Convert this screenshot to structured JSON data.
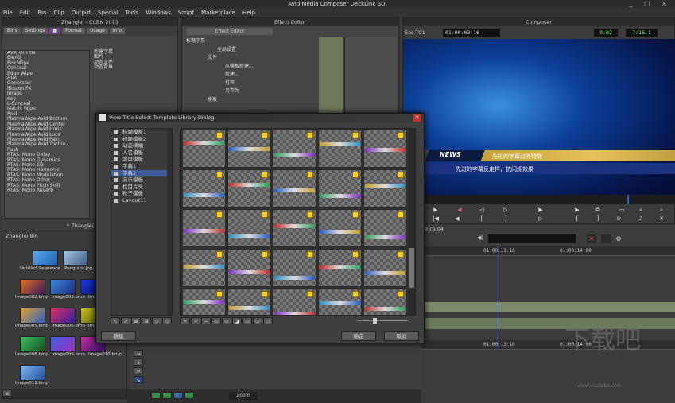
{
  "window": {
    "title": "Avid Media Composer DeckLink SDI",
    "controls": "_ □ ×"
  },
  "menu": [
    "File",
    "Edit",
    "Bin",
    "Clip",
    "Output",
    "Special",
    "Tools",
    "Windows",
    "Script",
    "Marketplace",
    "Help"
  ],
  "project": {
    "title": "Zhanglei - CCBN 2013",
    "tabs": [
      "Bins",
      "Settings",
      "Format",
      "Usage",
      "Info"
    ],
    "effects": [
      "AVX_UI Title",
      "Blend",
      "Box Wipe",
      "Conceal",
      "Edge Wipe",
      "Film",
      "Generator",
      "Illusion FX",
      "Image",
      "Key",
      "L-Conceal",
      "Matrix Wipe",
      "Peel",
      "PlasmaWipe Avid Bottom",
      "PlasmaWipe Avid Center",
      "PlasmaWipe Avid Horiz",
      "PlasmaWipe Avid Luca",
      "PlasmaWipe Avid Paint",
      "PlasmaWipe Avid Trichro",
      "Push",
      "RTAS: Mono Delay",
      "RTAS: Mono Dynamics",
      "RTAS: Mono EQ",
      "RTAS: Mono Harmonic",
      "RTAS: Mono Modulation",
      "RTAS: Mono Other",
      "RTAS: Mono Pitch Shift",
      "RTAS: Mono Reverb"
    ],
    "effect_types": [
      "新建字幕",
      "图片",
      "动态文件",
      "动态背景"
    ]
  },
  "effect_editor": {
    "title": "Effect Editor",
    "tab": "Effect Editor",
    "rows": [
      "标题字幕",
      "全局设置",
      "文件",
      "从模板新建...",
      "新建...",
      "打开",
      "另存为",
      "模板"
    ]
  },
  "composer": {
    "title": "Composer",
    "timecode_label": "Eas TC1",
    "timecode": "01:00:03:16",
    "right_tc_1": "9:02",
    "right_tc_2": "7:16.1",
    "news_label": "NEWS",
    "ticker_text": "先进的字幕对齐特效",
    "subtitle_text": "先进的字幕反走样，抗闪烁效果"
  },
  "bin": {
    "label": "* Zhanglei Bin",
    "title": "Zhanglei Bin",
    "items": [
      "Untitled Sequence",
      "Penguins.jpg",
      "Image002.bmp",
      "Image003.bmp",
      "Image004.bmp",
      "Image005.bmp",
      "Image006.bmp",
      "Image007.bmp",
      "Image008.bmp",
      "Image009.bmp",
      "Image010.bmp",
      "Image011.bmp"
    ]
  },
  "dialog": {
    "title": "VexelTitle Select Template Library Dialog",
    "tree": [
      "标题模板1",
      "标题模板2",
      "动态横幅",
      "人名模板",
      "滚屏模板",
      "字幕1",
      "字幕2",
      "演示模板",
      "栏目片头",
      "粒子模板",
      "Layout11"
    ],
    "selected_index": 6,
    "new_button": "新建",
    "ok_button": "确定",
    "cancel_button": "取消"
  },
  "timeline": {
    "sequence_label": "ence.04",
    "tc_a": "01:00:13:10",
    "tc_b": "01:00:14:00",
    "zoom_label": "Zoom"
  },
  "watermark": {
    "text": "下载吧",
    "url": "www.xiazaiba.com"
  }
}
